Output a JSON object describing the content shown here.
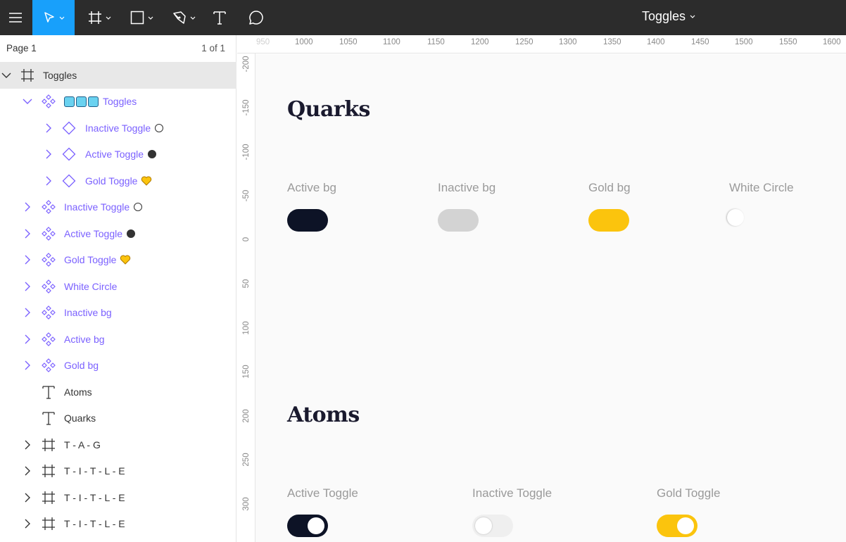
{
  "toolbar": {
    "file_title": "Toggles",
    "icons": [
      "menu-icon",
      "move-icon",
      "frame-icon",
      "rectangle-icon",
      "pen-icon",
      "text-icon",
      "comment-icon"
    ],
    "active_tool_color": "#18a0fb",
    "background": "#2c2c2c"
  },
  "layers_panel": {
    "page_name": "Page 1",
    "page_count": "1 of 1",
    "items": [
      {
        "label": "Toggles",
        "icon": "frame-icon",
        "expanded": true,
        "selected": true
      },
      {
        "label": "Toggles",
        "icon": "component-set-icon",
        "prefix_emoji": "🦄🦄🦄",
        "expanded": true
      },
      {
        "label": "Inactive Toggle",
        "icon": "variant-icon",
        "badge": "⚪"
      },
      {
        "label": "Active Toggle",
        "icon": "variant-icon",
        "badge": "⚫"
      },
      {
        "label": "Gold Toggle",
        "icon": "variant-icon",
        "badge": "💛"
      },
      {
        "label": "Inactive Toggle",
        "icon": "component-icon",
        "badge": "⚪"
      },
      {
        "label": "Active Toggle",
        "icon": "component-icon",
        "badge": "⚫"
      },
      {
        "label": "Gold Toggle",
        "icon": "component-icon",
        "badge": "💛"
      },
      {
        "label": "White Circle",
        "icon": "component-icon"
      },
      {
        "label": "Inactive bg",
        "icon": "component-icon"
      },
      {
        "label": "Active bg",
        "icon": "component-icon"
      },
      {
        "label": "Gold bg",
        "icon": "component-icon"
      },
      {
        "label": "Atoms",
        "icon": "text-layer-icon"
      },
      {
        "label": "Quarks",
        "icon": "text-layer-icon"
      },
      {
        "label": "T - A - G",
        "icon": "frame-icon"
      },
      {
        "label": "T - I - T - L - E",
        "icon": "frame-icon"
      },
      {
        "label": "T - I - T - L - E",
        "icon": "frame-icon"
      },
      {
        "label": "T - I - T - L - E",
        "icon": "frame-icon"
      }
    ]
  },
  "ruler": {
    "horizontal": [
      "950",
      "1000",
      "1050",
      "1100",
      "1150",
      "1200",
      "1250",
      "1300",
      "1350",
      "1400",
      "1450",
      "1500",
      "1550",
      "1600"
    ],
    "vertical": [
      "-200",
      "-150",
      "-100",
      "-50",
      "0",
      "50",
      "100",
      "150",
      "200",
      "250",
      "300"
    ]
  },
  "canvas": {
    "quarks": {
      "title": "Quarks",
      "items": [
        {
          "label": "Active bg",
          "color": "#0d1326"
        },
        {
          "label": "Inactive bg",
          "color": "#d3d3d3"
        },
        {
          "label": "Gold bg",
          "color": "#fbc40d"
        },
        {
          "label": "White Circle",
          "color": "#ffffff"
        }
      ]
    },
    "atoms": {
      "title": "Atoms",
      "items": [
        {
          "label": "Active Toggle",
          "color": "#0d1326",
          "state": "on"
        },
        {
          "label": "Inactive Toggle",
          "color": "#efefef",
          "state": "off"
        },
        {
          "label": "Gold Toggle",
          "color": "#fbc40d",
          "state": "on"
        }
      ]
    }
  },
  "colors": {
    "component_purple": "#7b61ff",
    "canvas_bg": "#fafafa",
    "selected_row": "#e8e8e8"
  }
}
